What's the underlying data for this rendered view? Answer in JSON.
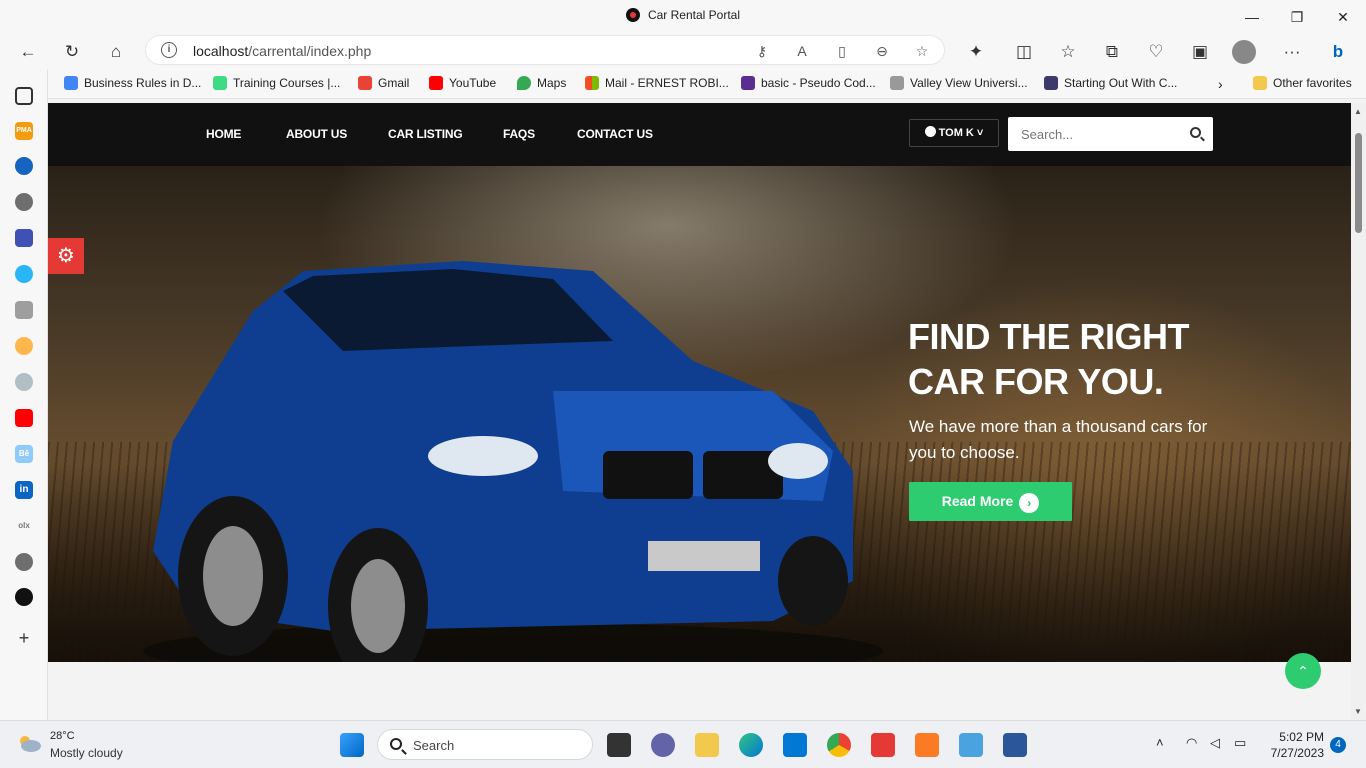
{
  "window": {
    "title": "Car Rental Portal",
    "minimize": "—",
    "maximize": "❐",
    "close": "✕"
  },
  "browser": {
    "url_host": "localhost",
    "url_path": "/carrental/index.php",
    "bookmarks": [
      "Business Rules in D...",
      "Training Courses |...",
      "Gmail",
      "YouTube",
      "Maps",
      "Mail - ERNEST ROBI...",
      "basic - Pseudo Cod...",
      "Valley View Universi...",
      "Starting Out With C..."
    ],
    "other_favorites": "Other favorites"
  },
  "site": {
    "nav": [
      "HOME",
      "ABOUT US",
      "CAR LISTING",
      "FAQS",
      "CONTACT US"
    ],
    "user": "TOM K",
    "search_placeholder": "Search...",
    "hero": {
      "title_line1": "FIND THE RIGHT",
      "title_line2": "CAR FOR YOU.",
      "subtitle": "We have more than a thousand cars for you to choose.",
      "button": "Read More"
    }
  },
  "taskbar": {
    "temp": "28°C",
    "condition": "Mostly cloudy",
    "search": "Search",
    "time": "5:02 PM",
    "date": "7/27/2023",
    "notifications": "4"
  },
  "colors": {
    "accent_green": "#2ecc71",
    "settings_red": "#e53935",
    "nav_bg": "#111111"
  }
}
